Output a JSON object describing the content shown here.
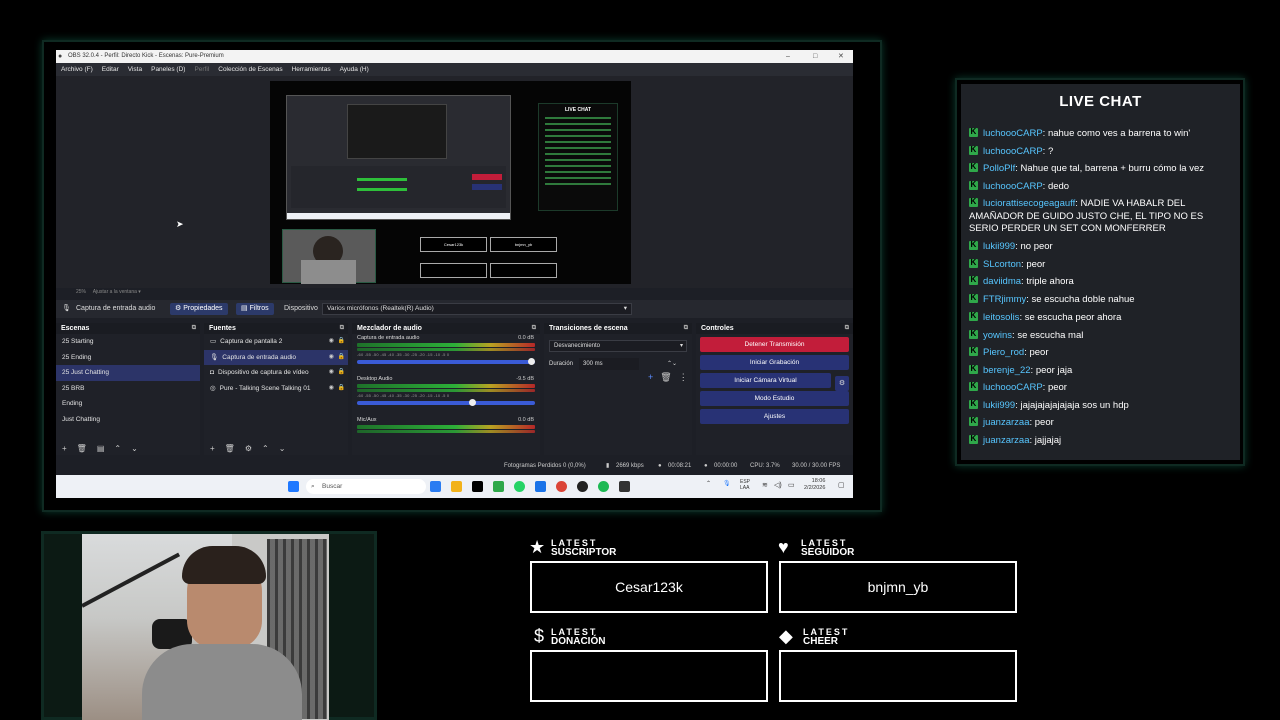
{
  "obs": {
    "title": "OBS 32.0.4 - Perfil: Directo Kick - Escenas: Pure-Premium",
    "menu": [
      "Archivo (F)",
      "Editar",
      "Vista",
      "Paneles (D)",
      "Perfil",
      "Colección de Escenas",
      "Herramientas",
      "Ayuda (H)"
    ],
    "preview": {
      "zoom_label": "25%",
      "fit_label": "Ajustar a la ventana",
      "mini_chat_title": "LIVE CHAT",
      "mini_alert_1": "Cesar123k",
      "mini_alert_2": "bnjmn_yb"
    },
    "source_toolbar": {
      "source_name": "Captura de entrada audio",
      "properties_label": "Propiedades",
      "filters_label": "Filtros",
      "device_label": "Dispositivo",
      "device_value": "Varios micrófonos (Realtek(R) Audio)"
    },
    "scenes": {
      "title": "Escenas",
      "items": [
        "25 Starting",
        "25 Ending",
        "25 Just Chatting",
        "25 BRB",
        "Ending",
        "Just Chatting"
      ],
      "selected_index": 2
    },
    "sources": {
      "title": "Fuentes",
      "items": [
        "Captura de pantalla 2",
        "Captura de entrada audio",
        "Dispositivo de captura de vídeo",
        "Pure - Talking Scene Talking 01"
      ],
      "selected_index": 1
    },
    "mixer": {
      "title": "Mezclador de audio",
      "scale": "-60 -55 -50 -45 -40 -35 -30 -25 -20 -15 -10 -5 0",
      "channels": [
        {
          "name": "Captura de entrada audio",
          "db": "0.0 dB",
          "volume": 1.0
        },
        {
          "name": "Desktop Audio",
          "db": "-9.5 dB",
          "volume": 0.67
        },
        {
          "name": "Mic/Aux",
          "db": "0.0 dB",
          "volume": 1.0
        }
      ]
    },
    "transitions": {
      "title": "Transiciones de escena",
      "selected": "Desvanecimiento",
      "duration_label": "Duración",
      "duration_value": "300 ms"
    },
    "controls": {
      "title": "Controles",
      "stop_stream": "Detener Transmisión",
      "start_recording": "Iniciar Grabación",
      "start_virtual_cam": "Iniciar Cámara Virtual",
      "studio_mode": "Modo Estudio",
      "settings": "Ajustes"
    },
    "status": {
      "dropped_frames": "Fotogramas Perdidos 0 (0,0%)",
      "bitrate": "2669 kbps",
      "stream_time": "00:08:21",
      "rec_time": "00:00:00",
      "cpu": "CPU: 3.7%",
      "fps": "30.00 / 30.00 FPS"
    },
    "taskbar": {
      "search_placeholder": "Buscar",
      "lang_top": "ESP",
      "lang_bottom": "LAA",
      "time": "18:06",
      "date": "2/2/2026"
    }
  },
  "chat": {
    "title": "LIVE CHAT",
    "messages": [
      {
        "user": "luchoooCARP",
        "text": "nahue como ves a barrena to win'"
      },
      {
        "user": "PolloPlf",
        "text": "Nahue que tal, barrena + burru cómo la vez"
      },
      {
        "user": "luchoooCARP",
        "text": "dedo"
      },
      {
        "user": "luciorattisecogeagauff",
        "text": "NADIE VA HABALR DEL AMAÑADOR DE GUIDO JUSTO CHE, EL TIPO NO ES SERIO PERDER UN SET CON MONFERRER"
      },
      {
        "user": "lukii999",
        "text": "no peor"
      },
      {
        "user": "SLcorton",
        "text": "peor"
      },
      {
        "user": "daviidma",
        "text": "triple ahora"
      },
      {
        "user": "FTRjimmy",
        "text": "se escucha doble nahue"
      },
      {
        "user": "leitosolis",
        "text": "se escucha peor ahora"
      },
      {
        "user": "yowins",
        "text": "se escucha mal"
      },
      {
        "user": "Piero_rod",
        "text": "peor"
      },
      {
        "user": "berenje_22",
        "text": "peor jaja"
      },
      {
        "user": "luchoooCARP",
        "text": "peor"
      },
      {
        "user": "lukii999",
        "text": "jajajajajajajaja sos un hdp"
      },
      {
        "user": "juanzarzaa",
        "text": "peor"
      },
      {
        "user": "juanzarzaa",
        "text": "jajjajaj"
      }
    ],
    "second_message_prefix": "?"
  },
  "alerts": {
    "latest_word": "LATEST",
    "suscriptor": {
      "label": "SUSCRIPTOR",
      "value": "Cesar123k"
    },
    "seguidor": {
      "label": "SEGUIDOR",
      "value": "bnjmn_yb"
    },
    "donacion": {
      "label": "DONACIÓN",
      "value": ""
    },
    "cheer": {
      "label": "CHEER",
      "value": ""
    }
  },
  "colors": {
    "accent_green": "#2fa84a",
    "chat_user": "#57c6ff",
    "stop_button": "#c21d3a",
    "obs_button": "#283275"
  }
}
